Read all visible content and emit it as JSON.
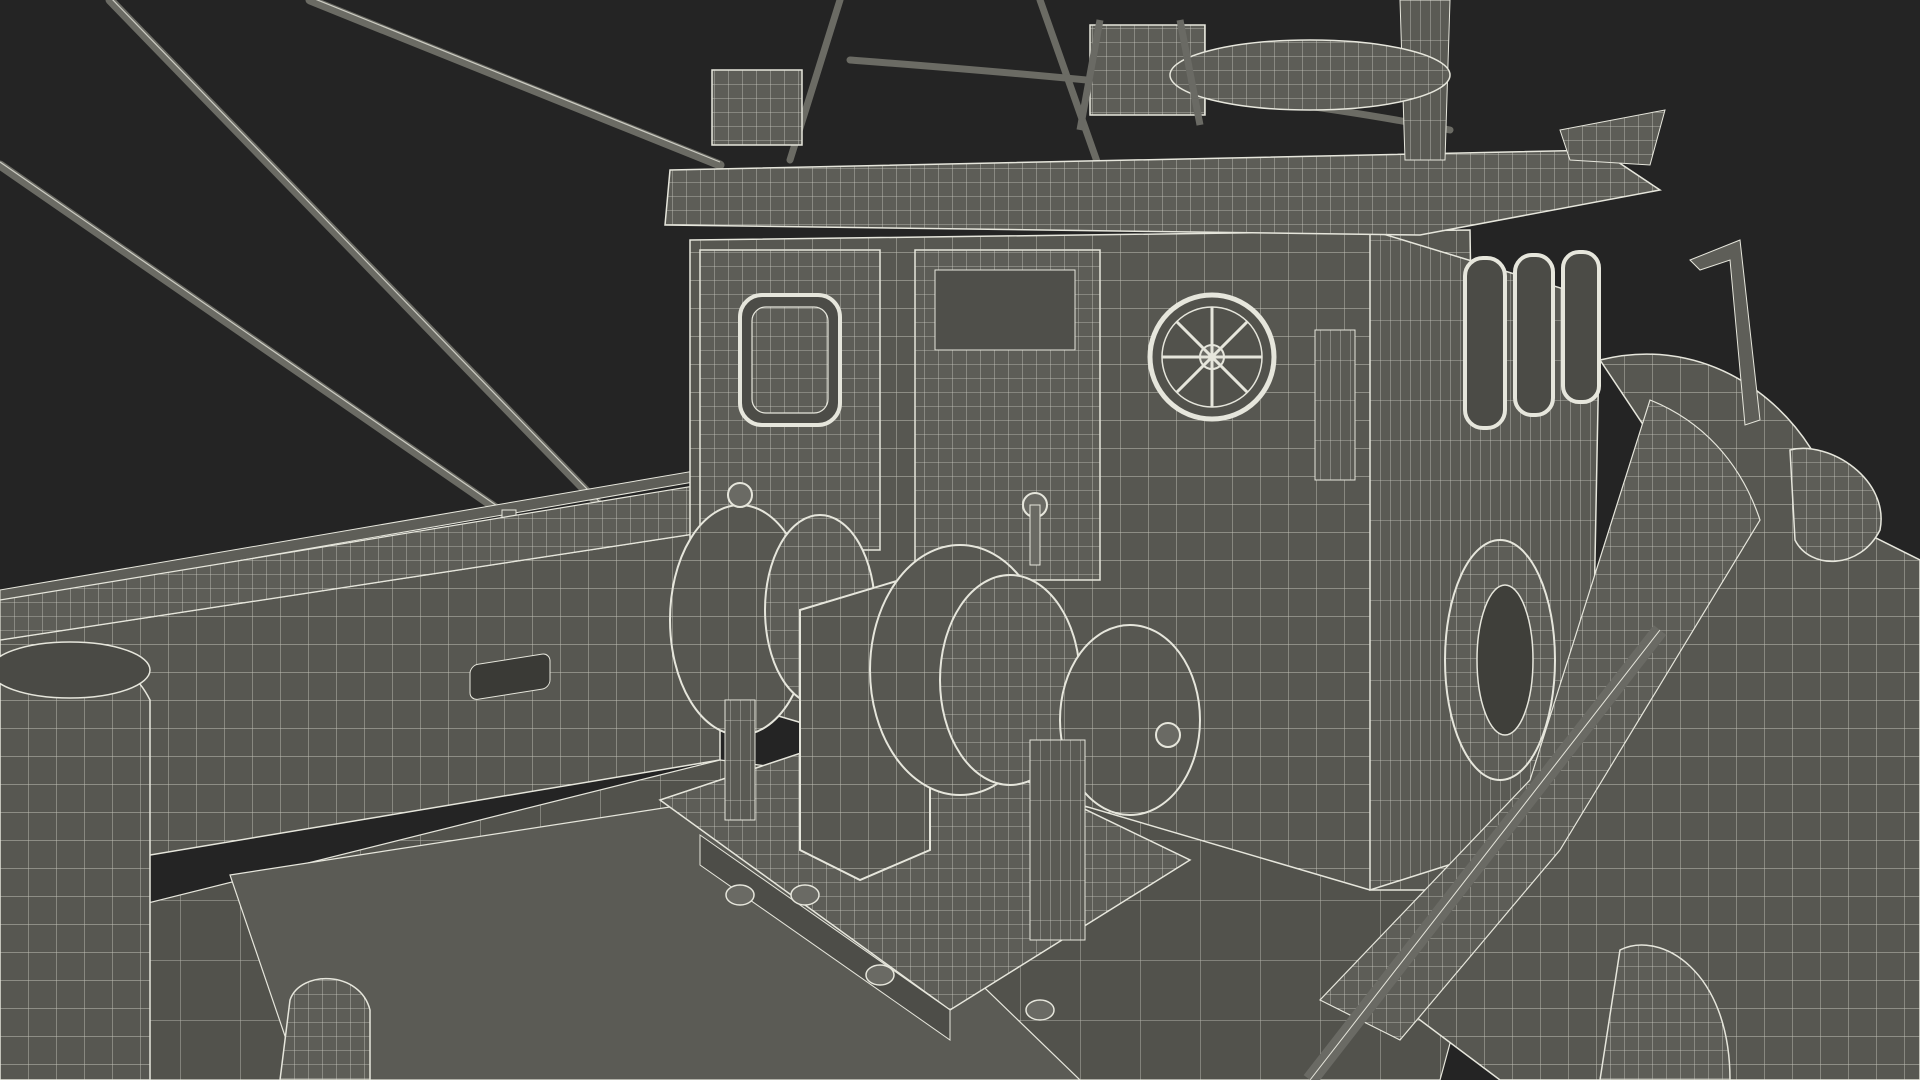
{
  "scene": {
    "subject": "fishing-boat-wireframe-render",
    "background_color": "#242424",
    "mesh_fill": "#575751",
    "mesh_fill_light": "#6a6a64",
    "mesh_fill_dark": "#45453f",
    "wire_color": "#e6e6dc"
  }
}
